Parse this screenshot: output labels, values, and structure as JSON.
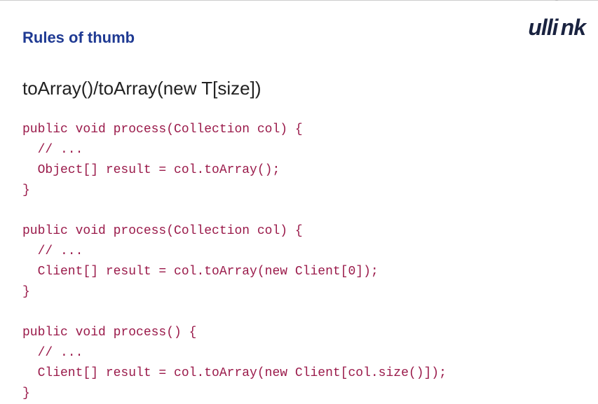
{
  "header": {
    "title": "Rules of thumb",
    "logo_text": "ullink"
  },
  "subtitle": "toArray()/toArray(new T[size])",
  "code": "public void process(Collection col) {\n  // ...\n  Object[] result = col.toArray();\n}\n\npublic void process(Collection col) {\n  // ...\n  Client[] result = col.toArray(new Client[0]);\n}\n\npublic void process() {\n  // ...\n  Client[] result = col.toArray(new Client[col.size()]);\n}"
}
